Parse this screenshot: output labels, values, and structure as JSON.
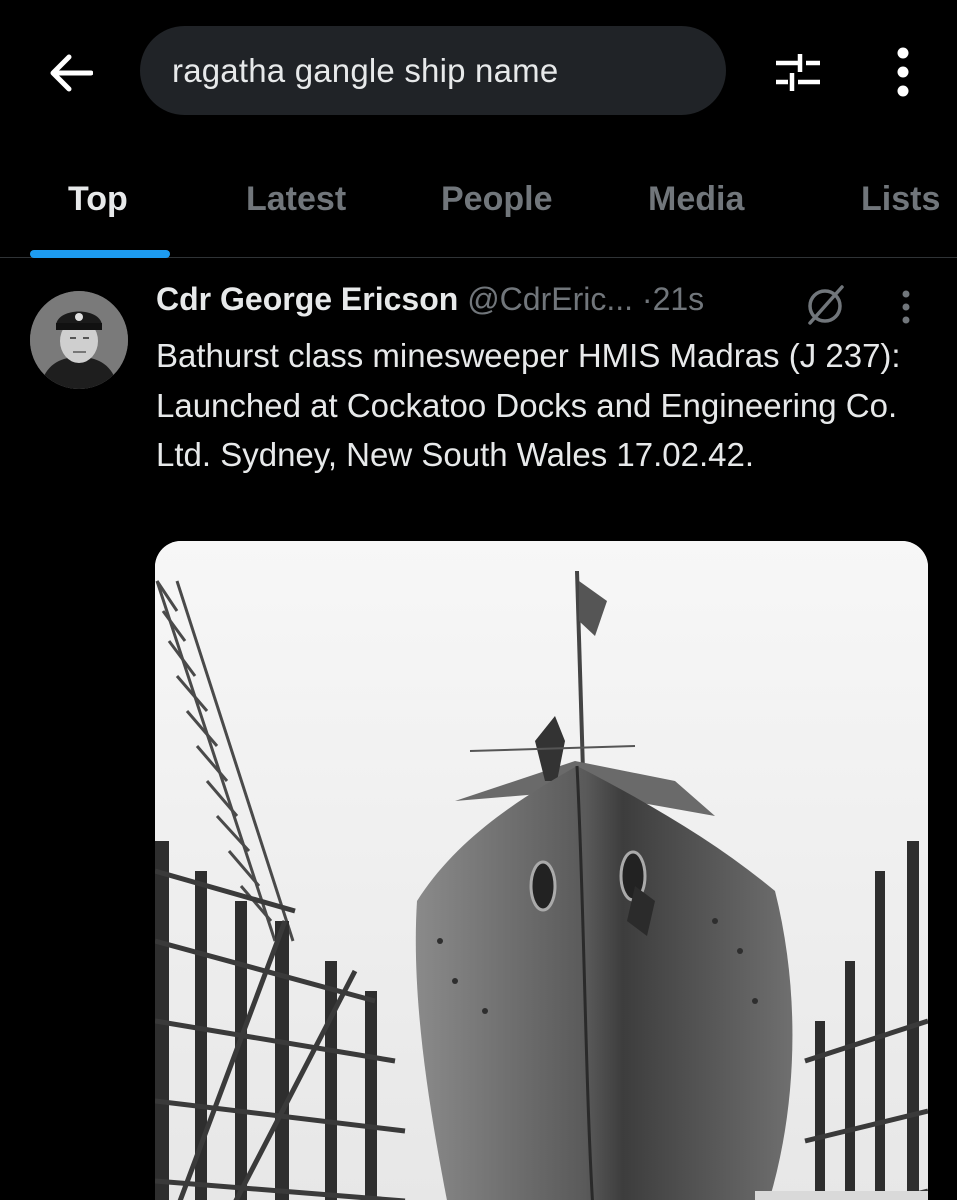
{
  "search": {
    "query": "ragatha gangle ship name"
  },
  "icons": {
    "back": "arrow-left-icon",
    "filter": "sliders-icon",
    "more": "more-vertical-icon",
    "grok": "grok-icon"
  },
  "tabs": [
    {
      "label": "Top",
      "active": true
    },
    {
      "label": "Latest",
      "active": false
    },
    {
      "label": "People",
      "active": false
    },
    {
      "label": "Media",
      "active": false
    },
    {
      "label": "Lists",
      "active": false
    }
  ],
  "tweet": {
    "author": "Cdr George Ericson",
    "handle": "@CdrEric...",
    "separator": "·",
    "time": "21s",
    "text": "Bathurst class minesweeper HMIS Madras (J 237): Launched at Cockatoo Docks and Engineering Co. Ltd. Sydney, New South Wales 17.02.42."
  },
  "colors": {
    "background": "#000000",
    "text": "#e7e9ea",
    "muted": "#71767b",
    "accent": "#1d9bf0",
    "search_bg": "#202327"
  }
}
